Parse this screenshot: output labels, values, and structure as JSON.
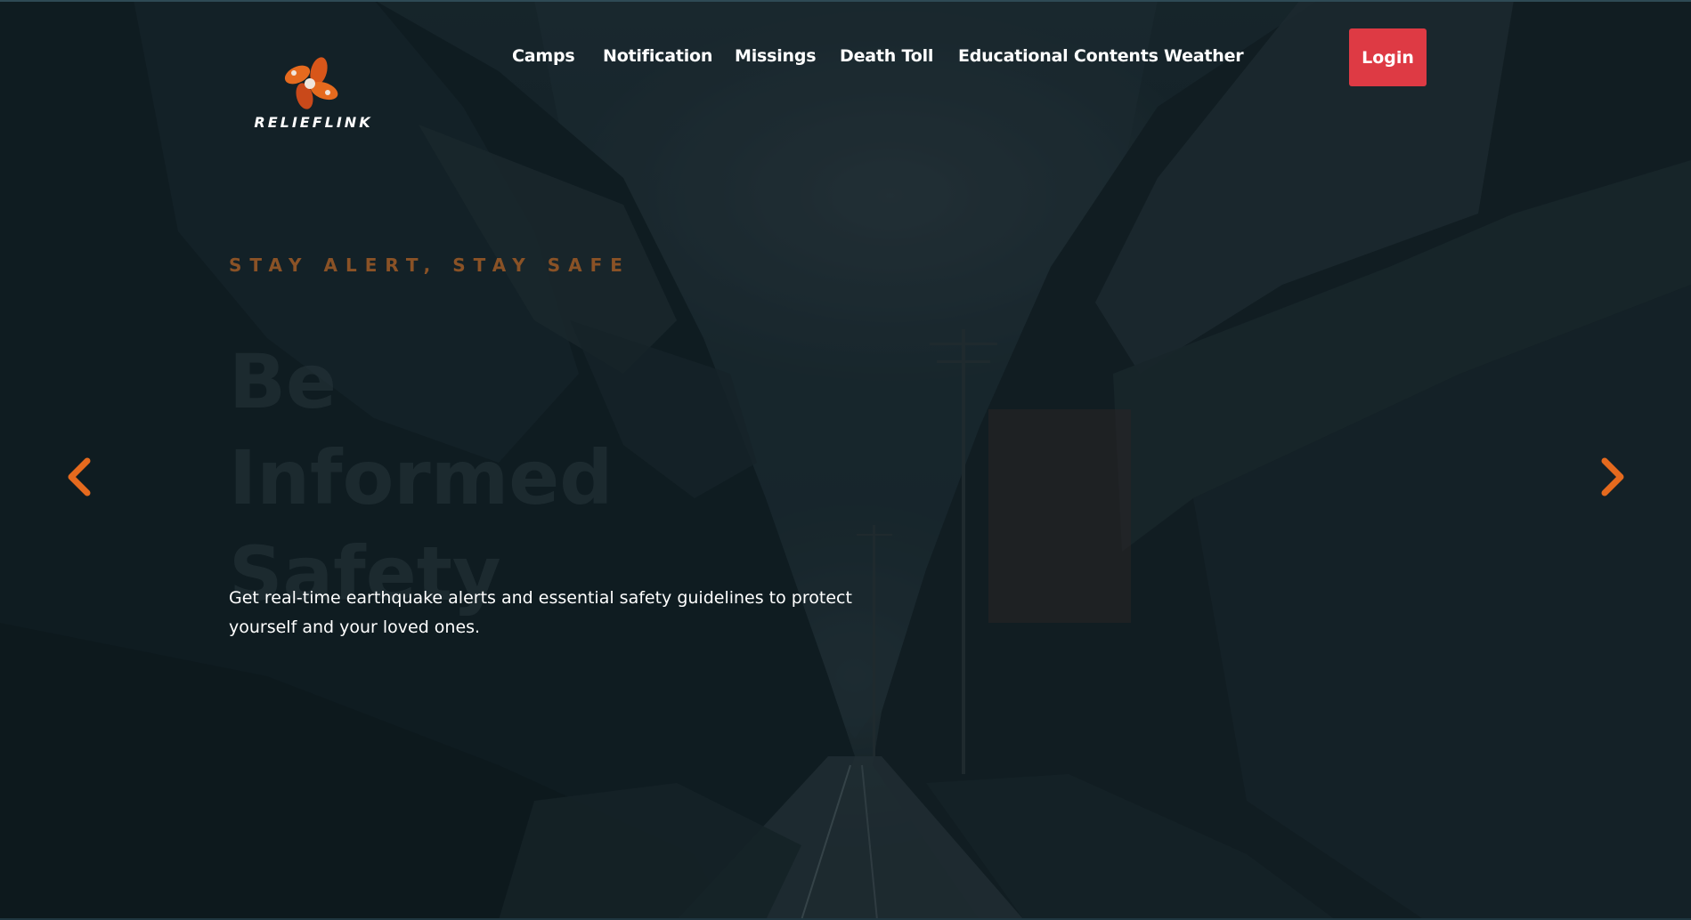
{
  "brand": {
    "name": "RELIEFLINK",
    "accent": "#e56a1e",
    "login_color": "#de3a44"
  },
  "nav": {
    "items": [
      {
        "label": "Camps"
      },
      {
        "label": "Notification"
      },
      {
        "label": "Missings"
      },
      {
        "label": "Death Toll"
      },
      {
        "label": "Educational Contents"
      },
      {
        "label": "Weather"
      }
    ],
    "login_label": "Login"
  },
  "hero": {
    "tagline": "STAY ALERT, STAY SAFE",
    "heading_lines": [
      "Be",
      "Informed",
      "Safety"
    ],
    "description": "Get real-time earthquake alerts and essential safety guidelines to protect yourself and your loved ones.",
    "prev_icon": "chevron-left-icon",
    "next_icon": "chevron-right-icon"
  }
}
